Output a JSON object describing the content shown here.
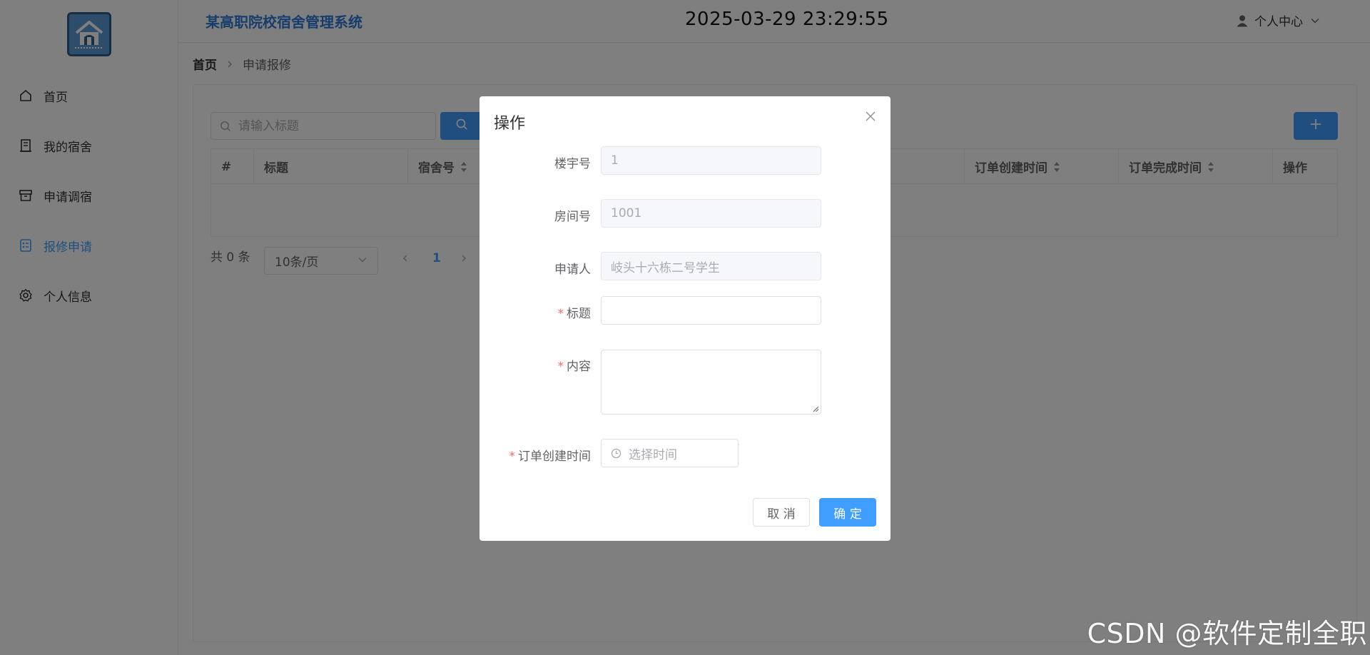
{
  "app": {
    "title": "某高职院校宿舍管理系统",
    "clock": "2025-03-29 23:29:55",
    "user_menu_label": "个人中心",
    "primary_color": "#409eff"
  },
  "sidebar": {
    "logo_icon": "house-logo-icon",
    "items": [
      {
        "label": "首页",
        "icon": "home-icon"
      },
      {
        "label": "我的宿舍",
        "icon": "building-icon"
      },
      {
        "label": "申请调宿",
        "icon": "box-icon"
      },
      {
        "label": "报修申请",
        "icon": "repair-form-icon",
        "active": true
      },
      {
        "label": "个人信息",
        "icon": "gear-icon"
      }
    ]
  },
  "breadcrumb": {
    "home": "首页",
    "current": "申请报修"
  },
  "toolbar": {
    "search_placeholder": "请输入标题",
    "add_symbol": "+"
  },
  "table": {
    "columns": [
      {
        "label": "#"
      },
      {
        "label": "标题"
      },
      {
        "label": "宿舍号",
        "sortable": true
      },
      {
        "label": "订单创建时间",
        "sortable": true
      },
      {
        "label": "订单完成时间",
        "sortable": true
      },
      {
        "label": "操作"
      }
    ],
    "rows": []
  },
  "pagination": {
    "total_text": "共 0 条",
    "page_size": "10条/页",
    "current_page": "1"
  },
  "dialog": {
    "title": "操作",
    "fields": {
      "building_label": "楼宇号",
      "building_value": "1",
      "room_label": "房间号",
      "room_value": "1001",
      "applicant_label": "申请人",
      "applicant_value": "岐头十六栋二号学生",
      "title_label": "标题",
      "content_label": "内容",
      "created_label": "订单创建时间",
      "created_placeholder": "选择时间",
      "required_mark": "*"
    },
    "cancel_label": "取 消",
    "ok_label": "确 定"
  },
  "watermark": "CSDN @软件定制全职"
}
